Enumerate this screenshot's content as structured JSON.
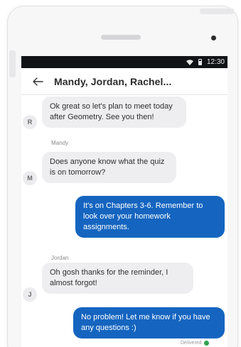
{
  "status_bar": {
    "time": "12:30"
  },
  "header": {
    "title": "Mandy, Jordan, Rachel..."
  },
  "messages": [
    {
      "initial": "R",
      "sender": "",
      "text": "Ok great so let's plan to meet today after Geometry. See you then!"
    },
    {
      "initial": "M",
      "sender": "Mandy",
      "text": "Does anyone know what the quiz is on tomorrow?"
    },
    {
      "initial": "",
      "sender": "",
      "text": "It's on Chapters 3-6. Remember to look over your homework assignments."
    },
    {
      "initial": "J",
      "sender": "Jordan",
      "text": "Oh gosh thanks for the reminder, I almost forgot!"
    },
    {
      "initial": "",
      "sender": "",
      "text": "No problem! Let me know if you have any questions :)"
    }
  ],
  "read_receipt": "Delivered",
  "colors": {
    "outgoing": "#1565c0",
    "incoming": "#eeeef0",
    "status_bar": "#111317",
    "receipt_dot": "#2ea44f"
  },
  "icons": {
    "back": "arrow-left-icon",
    "wifi": "wifi-icon",
    "battery": "battery-icon"
  }
}
